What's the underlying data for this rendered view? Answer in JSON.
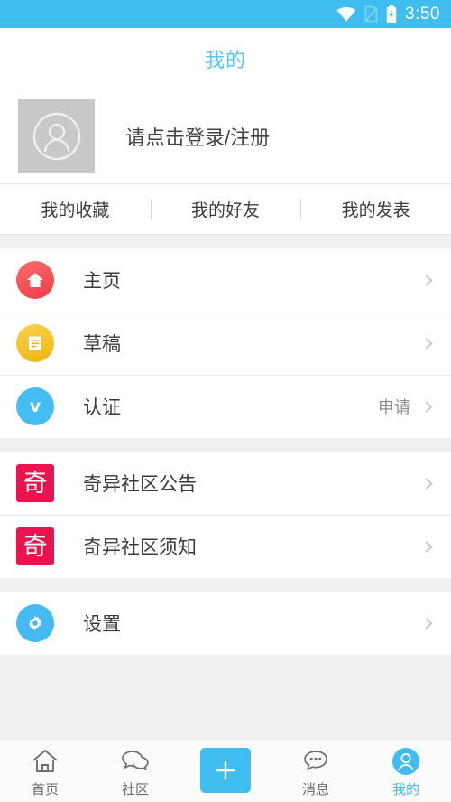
{
  "status_bar": {
    "time": "3:50",
    "icons": [
      "wifi-icon",
      "sim-card-missing-icon",
      "battery-charging-icon"
    ],
    "background_color": "#3fbdef"
  },
  "header": {
    "title": "我的",
    "title_color": "#55c7f2"
  },
  "profile": {
    "avatar_icon": "default-user-avatar",
    "login_prompt": "请点击登录/注册"
  },
  "quick_tabs": [
    {
      "label": "我的收藏",
      "name": "my-favorites"
    },
    {
      "label": "我的好友",
      "name": "my-friends"
    },
    {
      "label": "我的发表",
      "name": "my-posts"
    }
  ],
  "groups": [
    {
      "rows": [
        {
          "label": "主页",
          "icon": "home-icon",
          "icon_color": "#ef3d46",
          "value": "",
          "chevron": true
        },
        {
          "label": "草稿",
          "icon": "draft-icon",
          "icon_color": "#eeb60c",
          "value": "",
          "chevron": true
        },
        {
          "label": "认证",
          "icon": "verified-v-icon",
          "icon_color": "#45bdf2",
          "value": "申请",
          "chevron": true
        }
      ]
    },
    {
      "rows": [
        {
          "label": "奇异社区公告",
          "icon": "qiyi-badge-icon",
          "icon_color": "#e8134f",
          "icon_char": "奇",
          "value": "",
          "chevron": true
        },
        {
          "label": "奇异社区须知",
          "icon": "qiyi-badge-icon",
          "icon_color": "#e8134f",
          "icon_char": "奇",
          "value": "",
          "chevron": true
        }
      ]
    },
    {
      "rows": [
        {
          "label": "设置",
          "icon": "gear-icon",
          "icon_color": "#45b9f2",
          "value": "",
          "chevron": true
        }
      ]
    }
  ],
  "bottom_nav": {
    "active_color": "#40bcef",
    "items": [
      {
        "label": "首页",
        "icon": "home-outline-icon",
        "active": false
      },
      {
        "label": "社区",
        "icon": "chat-bubbles-icon",
        "active": false
      },
      {
        "label": "",
        "icon": "plus-icon",
        "active": false
      },
      {
        "label": "消息",
        "icon": "message-dots-icon",
        "active": false
      },
      {
        "label": "我的",
        "icon": "user-circle-icon",
        "active": true
      }
    ]
  }
}
